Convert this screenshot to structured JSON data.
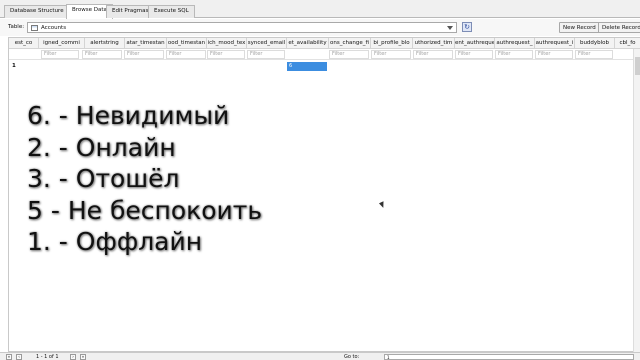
{
  "tabs": [
    {
      "label": "Database Structure",
      "active": false
    },
    {
      "label": "Browse Data",
      "active": true
    },
    {
      "label": "Edit Pragmas",
      "active": false
    },
    {
      "label": "Execute SQL",
      "active": false
    }
  ],
  "toolbar": {
    "table_label": "Table:",
    "table_value": "Accounts",
    "new_record": "New Record",
    "delete_record": "Delete Record"
  },
  "grid": {
    "columns": [
      "est_co",
      "igned_commi",
      "alertstring",
      "atar_timestan",
      "ood_timestan",
      "ich_mood_tex",
      "synced_email",
      "et_availability",
      "ons_change_fi",
      "bi_profile_blo",
      "uthorized_tim",
      "ent_authreque",
      "authrequest_",
      "authrequest_i",
      "buddyblob",
      "cbl_fo"
    ],
    "filter_placeholder": "Filter",
    "row_number": "1",
    "selected_value": "6"
  },
  "overlay": {
    "lines": [
      "6. - Невидимый",
      "2. - Онлайн",
      "3. - Отошёл",
      "5 - Не беспокоить",
      "1. - Оффлайн"
    ]
  },
  "status": {
    "records": "1 - 1 of 1",
    "goto_label": "Go to:",
    "goto_value": "1"
  }
}
